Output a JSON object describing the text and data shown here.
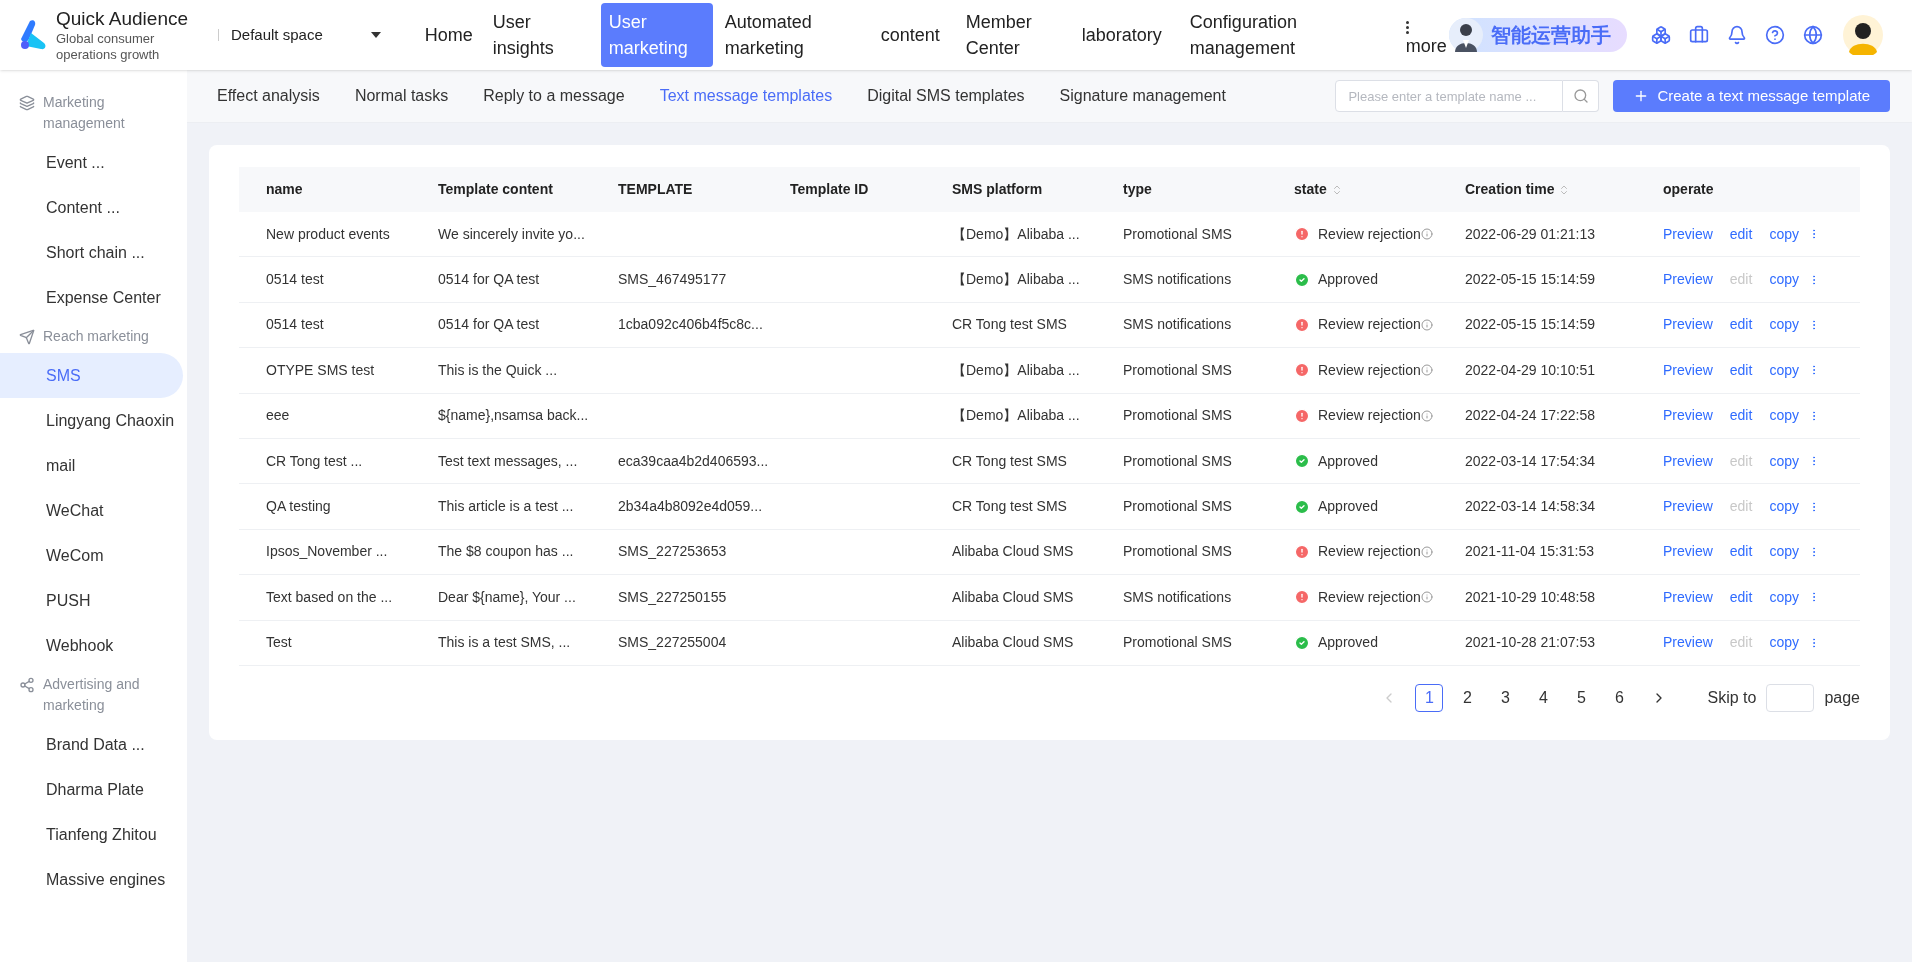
{
  "brand": {
    "name": "Quick Audience",
    "tagline": "Global consumer operations growth"
  },
  "space_selector": {
    "value": "Default space"
  },
  "nav": [
    {
      "label": "Home",
      "selected": false
    },
    {
      "label": "User insights",
      "selected": false
    },
    {
      "label": "User marketing",
      "selected": true
    },
    {
      "label": "Automated marketing",
      "selected": false
    },
    {
      "label": "content",
      "selected": false
    },
    {
      "label": "Member Center",
      "selected": false
    },
    {
      "label": "laboratory",
      "selected": false
    },
    {
      "label": "Configuration management",
      "selected": false
    }
  ],
  "more": {
    "label": "more"
  },
  "assistant": {
    "label": "智能运营助手"
  },
  "sidebar": [
    {
      "title": "Marketing management",
      "kind": "layers",
      "items": [
        {
          "label": "Event ...",
          "selected": false
        },
        {
          "label": "Content ...",
          "selected": false
        },
        {
          "label": "Short chain ...",
          "selected": false
        },
        {
          "label": "Expense Center",
          "selected": false
        }
      ]
    },
    {
      "title": "Reach marketing",
      "kind": "send",
      "items": [
        {
          "label": "SMS",
          "selected": true
        },
        {
          "label": "Lingyang Chaoxin",
          "selected": false
        },
        {
          "label": "mail",
          "selected": false
        },
        {
          "label": "WeChat",
          "selected": false
        },
        {
          "label": "WeCom",
          "selected": false
        },
        {
          "label": "PUSH",
          "selected": false
        },
        {
          "label": "Webhook",
          "selected": false
        }
      ]
    },
    {
      "title": "Advertising and marketing",
      "kind": "network",
      "items": [
        {
          "label": "Brand Data ...",
          "selected": false
        },
        {
          "label": "Dharma Plate",
          "selected": false
        },
        {
          "label": "Tianfeng Zhitou",
          "selected": false
        },
        {
          "label": "Massive engines",
          "selected": false
        }
      ]
    }
  ],
  "tabs": [
    {
      "label": "Effect analysis",
      "selected": false
    },
    {
      "label": "Normal tasks",
      "selected": false
    },
    {
      "label": "Reply to a message",
      "selected": false
    },
    {
      "label": "Text message templates",
      "selected": true
    },
    {
      "label": "Digital SMS templates",
      "selected": false
    },
    {
      "label": "Signature management",
      "selected": false
    }
  ],
  "search": {
    "placeholder": "Please enter a template name ..."
  },
  "create_button": {
    "label": "Create a text message template"
  },
  "table": {
    "columns": [
      {
        "label": "name",
        "sortable": false
      },
      {
        "label": "Template content",
        "sortable": false
      },
      {
        "label": "TEMPLATE",
        "sortable": false
      },
      {
        "label": "Template ID",
        "sortable": false
      },
      {
        "label": "SMS platform",
        "sortable": false
      },
      {
        "label": "type",
        "sortable": false
      },
      {
        "label": "state",
        "sortable": true
      },
      {
        "label": "Creation time",
        "sortable": true
      },
      {
        "label": "operate",
        "sortable": false
      }
    ],
    "rows": [
      {
        "name": "New product events",
        "content": "We sincerely invite yo...",
        "template": "",
        "platform": "【Demo】Alibaba ...",
        "type": "Promotional SMS",
        "state": {
          "kind": "rejected",
          "label": "Review rejection"
        },
        "time": "2022-06-29 01:21:13",
        "actions": {
          "preview": "Preview",
          "edit": "edit",
          "edit_disabled": false,
          "copy": "copy"
        }
      },
      {
        "name": "0514 test",
        "content": "0514 for QA test",
        "template": "SMS_467495177",
        "platform": "【Demo】Alibaba ...",
        "type": "SMS notifications",
        "state": {
          "kind": "approved",
          "label": "Approved"
        },
        "time": "2022-05-15 15:14:59",
        "actions": {
          "preview": "Preview",
          "edit": "edit",
          "edit_disabled": true,
          "copy": "copy"
        }
      },
      {
        "name": "0514 test",
        "content": "0514 for QA test",
        "template": "1cba092c406b4f5c8c...",
        "platform": "CR Tong test SMS",
        "type": "SMS notifications",
        "state": {
          "kind": "rejected",
          "label": "Review rejection"
        },
        "time": "2022-05-15 15:14:59",
        "actions": {
          "preview": "Preview",
          "edit": "edit",
          "edit_disabled": false,
          "copy": "copy"
        }
      },
      {
        "name": "OTYPE SMS test",
        "content": "This is the Quick ...",
        "template": "",
        "platform": "【Demo】Alibaba ...",
        "type": "Promotional SMS",
        "state": {
          "kind": "rejected",
          "label": "Review rejection"
        },
        "time": "2022-04-29 10:10:51",
        "actions": {
          "preview": "Preview",
          "edit": "edit",
          "edit_disabled": false,
          "copy": "copy"
        }
      },
      {
        "name": "eee",
        "content": "${name},nsamsa back...",
        "template": "",
        "platform": "【Demo】Alibaba ...",
        "type": "Promotional SMS",
        "state": {
          "kind": "rejected",
          "label": "Review rejection"
        },
        "time": "2022-04-24 17:22:58",
        "actions": {
          "preview": "Preview",
          "edit": "edit",
          "edit_disabled": false,
          "copy": "copy"
        }
      },
      {
        "name": "CR Tong test ...",
        "content": "Test text messages, ...",
        "template": "eca39caa4b2d406593...",
        "platform": "CR Tong test SMS",
        "type": "Promotional SMS",
        "state": {
          "kind": "approved",
          "label": "Approved"
        },
        "time": "2022-03-14 17:54:34",
        "actions": {
          "preview": "Preview",
          "edit": "edit",
          "edit_disabled": true,
          "copy": "copy"
        }
      },
      {
        "name": "QA testing",
        "content": "This article is a test ...",
        "template": "2b34a4b8092e4d059...",
        "platform": "CR Tong test SMS",
        "type": "Promotional SMS",
        "state": {
          "kind": "approved",
          "label": "Approved"
        },
        "time": "2022-03-14 14:58:34",
        "actions": {
          "preview": "Preview",
          "edit": "edit",
          "edit_disabled": true,
          "copy": "copy"
        }
      },
      {
        "name": "Ipsos_November ...",
        "content": "The $8 coupon has ...",
        "template": "SMS_227253653",
        "platform": "Alibaba Cloud SMS",
        "type": "Promotional SMS",
        "state": {
          "kind": "rejected",
          "label": "Review rejection"
        },
        "time": "2021-11-04 15:31:53",
        "actions": {
          "preview": "Preview",
          "edit": "edit",
          "edit_disabled": false,
          "copy": "copy"
        }
      },
      {
        "name": "Text based on the ...",
        "content": "Dear ${name}, Your ...",
        "template": "SMS_227250155",
        "platform": "Alibaba Cloud SMS",
        "type": "SMS notifications",
        "state": {
          "kind": "rejected",
          "label": "Review rejection"
        },
        "time": "2021-10-29 10:48:58",
        "actions": {
          "preview": "Preview",
          "edit": "edit",
          "edit_disabled": false,
          "copy": "copy"
        }
      },
      {
        "name": "Test",
        "content": "This is a test SMS, ...",
        "template": "SMS_227255004",
        "platform": "Alibaba Cloud SMS",
        "type": "Promotional SMS",
        "state": {
          "kind": "approved",
          "label": "Approved"
        },
        "time": "2021-10-28 21:07:53",
        "actions": {
          "preview": "Preview",
          "edit": "edit",
          "edit_disabled": true,
          "copy": "copy"
        }
      }
    ]
  },
  "pagination": {
    "pages": [
      {
        "label": "1",
        "selected": true
      },
      {
        "label": "2",
        "selected": false
      },
      {
        "label": "3",
        "selected": false
      },
      {
        "label": "4",
        "selected": false
      },
      {
        "label": "5",
        "selected": false
      },
      {
        "label": "6",
        "selected": false
      }
    ],
    "skip_label": "Skip to",
    "page_label": "page"
  }
}
